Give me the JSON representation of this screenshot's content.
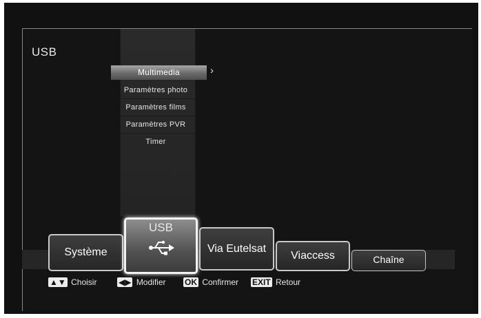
{
  "header": {
    "title": "USB"
  },
  "submenu": {
    "items": [
      {
        "label": "Multimedia",
        "selected": true
      },
      {
        "label": "Paramètres photo"
      },
      {
        "label": "Paramètres films"
      },
      {
        "label": "Paramètres PVR"
      },
      {
        "label": "Timer"
      }
    ],
    "arrow": "›"
  },
  "tabs": {
    "systeme": "Système",
    "usb": "USB",
    "via_eutelsat": "Via Eutelsat",
    "viaccess": "Viaccess",
    "chaine": "Chaîne",
    "selected": "USB",
    "usb_icon": "usb-icon"
  },
  "help": {
    "choose_key": "▲▼",
    "choose": "Choisir",
    "modify_key": "◀▶",
    "modify": "Modifier",
    "ok_key": "OK",
    "confirm": "Confirmer",
    "exit_key": "EXIT",
    "back": "Retour"
  },
  "colors": {
    "background": "#111111",
    "accent": "#f2f2f2",
    "text": "#e6e6e6"
  }
}
